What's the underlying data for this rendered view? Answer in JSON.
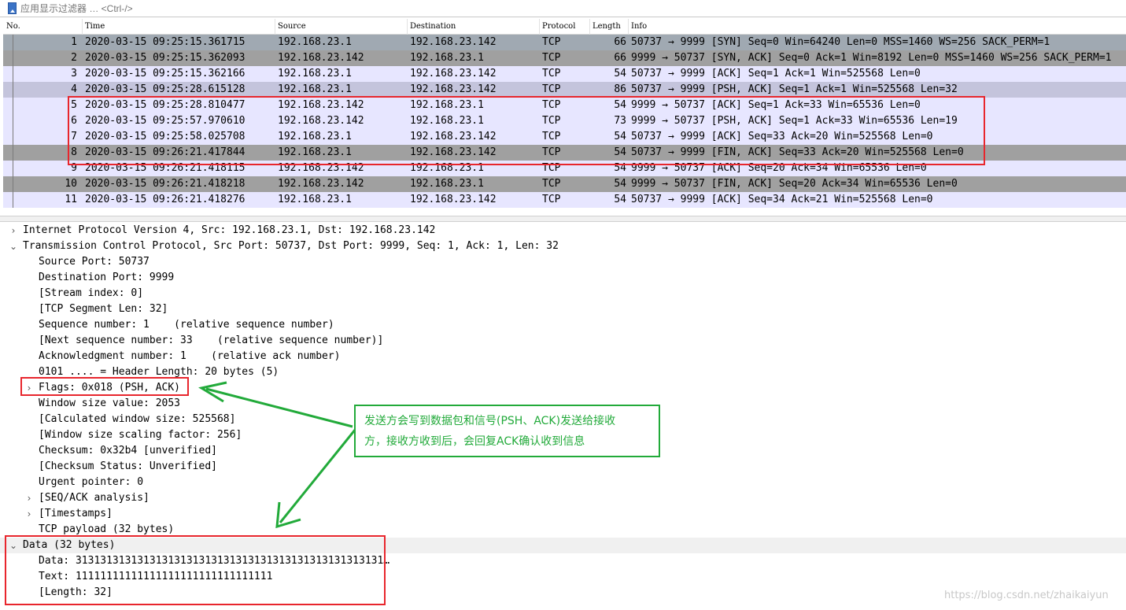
{
  "filter": {
    "placeholder": "应用显示过滤器 … <Ctrl-/>"
  },
  "packet_list": {
    "columns": {
      "no": "No.",
      "time": "Time",
      "source": "Source",
      "destination": "Destination",
      "protocol": "Protocol",
      "length": "Length",
      "info": "Info"
    },
    "rows": [
      {
        "no": "1",
        "time": "2020-03-15 09:25:15.361715",
        "source": "192.168.23.1",
        "destination": "192.168.23.142",
        "protocol": "TCP",
        "length": "66",
        "info": "50737 → 9999 [SYN] Seq=0 Win=64240 Len=0 MSS=1460 WS=256 SACK_PERM=1",
        "bg": "#a0a9b2"
      },
      {
        "no": "2",
        "time": "2020-03-15 09:25:15.362093",
        "source": "192.168.23.142",
        "destination": "192.168.23.1",
        "protocol": "TCP",
        "length": "66",
        "info": "9999 → 50737 [SYN, ACK] Seq=0 Ack=1 Win=8192 Len=0 MSS=1460 WS=256 SACK_PERM=1",
        "bg": "#a0a0a0"
      },
      {
        "no": "3",
        "time": "2020-03-15 09:25:15.362166",
        "source": "192.168.23.1",
        "destination": "192.168.23.142",
        "protocol": "TCP",
        "length": "54",
        "info": "50737 → 9999 [ACK] Seq=1 Ack=1 Win=525568 Len=0",
        "bg": "#e7e6ff"
      },
      {
        "no": "4",
        "time": "2020-03-15 09:25:28.615128",
        "source": "192.168.23.1",
        "destination": "192.168.23.142",
        "protocol": "TCP",
        "length": "86",
        "info": "50737 → 9999 [PSH, ACK] Seq=1 Ack=1 Win=525568 Len=32",
        "bg": "#c4c4dc"
      },
      {
        "no": "5",
        "time": "2020-03-15 09:25:28.810477",
        "source": "192.168.23.142",
        "destination": "192.168.23.1",
        "protocol": "TCP",
        "length": "54",
        "info": "9999 → 50737 [ACK] Seq=1 Ack=33 Win=65536 Len=0",
        "bg": "#e7e6ff"
      },
      {
        "no": "6",
        "time": "2020-03-15 09:25:57.970610",
        "source": "192.168.23.142",
        "destination": "192.168.23.1",
        "protocol": "TCP",
        "length": "73",
        "info": "9999 → 50737 [PSH, ACK] Seq=1 Ack=33 Win=65536 Len=19",
        "bg": "#e7e6ff"
      },
      {
        "no": "7",
        "time": "2020-03-15 09:25:58.025708",
        "source": "192.168.23.1",
        "destination": "192.168.23.142",
        "protocol": "TCP",
        "length": "54",
        "info": "50737 → 9999 [ACK] Seq=33 Ack=20 Win=525568 Len=0",
        "bg": "#e7e6ff"
      },
      {
        "no": "8",
        "time": "2020-03-15 09:26:21.417844",
        "source": "192.168.23.1",
        "destination": "192.168.23.142",
        "protocol": "TCP",
        "length": "54",
        "info": "50737 → 9999 [FIN, ACK] Seq=33 Ack=20 Win=525568 Len=0",
        "bg": "#a0a0a0"
      },
      {
        "no": "9",
        "time": "2020-03-15 09:26:21.418115",
        "source": "192.168.23.142",
        "destination": "192.168.23.1",
        "protocol": "TCP",
        "length": "54",
        "info": "9999 → 50737 [ACK] Seq=20 Ack=34 Win=65536 Len=0",
        "bg": "#e7e6ff"
      },
      {
        "no": "10",
        "time": "2020-03-15 09:26:21.418218",
        "source": "192.168.23.142",
        "destination": "192.168.23.1",
        "protocol": "TCP",
        "length": "54",
        "info": "9999 → 50737 [FIN, ACK] Seq=20 Ack=34 Win=65536 Len=0",
        "bg": "#a0a0a0"
      },
      {
        "no": "11",
        "time": "2020-03-15 09:26:21.418276",
        "source": "192.168.23.1",
        "destination": "192.168.23.142",
        "protocol": "TCP",
        "length": "54",
        "info": "50737 → 9999 [ACK] Seq=34 Ack=21 Win=525568 Len=0",
        "bg": "#e7e6ff"
      }
    ]
  },
  "details": [
    {
      "text": "Internet Protocol Version 4, Src: 192.168.23.1, Dst: 192.168.23.142",
      "level": 0,
      "arrow": "›"
    },
    {
      "text": "Transmission Control Protocol, Src Port: 50737, Dst Port: 9999, Seq: 1, Ack: 1, Len: 32",
      "level": 0,
      "arrow": "⌄"
    },
    {
      "text": "Source Port: 50737",
      "level": 1,
      "arrow": ""
    },
    {
      "text": "Destination Port: 9999",
      "level": 1,
      "arrow": ""
    },
    {
      "text": "[Stream index: 0]",
      "level": 1,
      "arrow": ""
    },
    {
      "text": "[TCP Segment Len: 32]",
      "level": 1,
      "arrow": ""
    },
    {
      "text": "Sequence number: 1    (relative sequence number)",
      "level": 1,
      "arrow": ""
    },
    {
      "text": "[Next sequence number: 33    (relative sequence number)]",
      "level": 1,
      "arrow": ""
    },
    {
      "text": "Acknowledgment number: 1    (relative ack number)",
      "level": 1,
      "arrow": ""
    },
    {
      "text": "0101 .... = Header Length: 20 bytes (5)",
      "level": 1,
      "arrow": ""
    },
    {
      "text": "Flags: 0x018 (PSH, ACK)",
      "level": 1,
      "arrow": "›"
    },
    {
      "text": "Window size value: 2053",
      "level": 1,
      "arrow": ""
    },
    {
      "text": "[Calculated window size: 525568]",
      "level": 1,
      "arrow": ""
    },
    {
      "text": "[Window size scaling factor: 256]",
      "level": 1,
      "arrow": ""
    },
    {
      "text": "Checksum: 0x32b4 [unverified]",
      "level": 1,
      "arrow": ""
    },
    {
      "text": "[Checksum Status: Unverified]",
      "level": 1,
      "arrow": ""
    },
    {
      "text": "Urgent pointer: 0",
      "level": 1,
      "arrow": ""
    },
    {
      "text": "[SEQ/ACK analysis]",
      "level": 1,
      "arrow": "›"
    },
    {
      "text": "[Timestamps]",
      "level": 1,
      "arrow": "›"
    },
    {
      "text": "TCP payload (32 bytes)",
      "level": 1,
      "arrow": ""
    },
    {
      "text": "Data (32 bytes)",
      "level": 0,
      "arrow": "⌄",
      "selected": true
    },
    {
      "text": "Data: 31313131313131313131313131313131313131313131313131…",
      "level": 1,
      "arrow": ""
    },
    {
      "text": "Text: 11111111111111111111111111111111",
      "level": 1,
      "arrow": ""
    },
    {
      "text": "[Length: 32]",
      "level": 1,
      "arrow": ""
    }
  ],
  "annotation": {
    "callout_line1": "发送方会写到数据包和信号(PSH、ACK)发送给接收",
    "callout_line2": "方，接收方收到后，会回复ACK确认收到信息"
  },
  "watermark": "https://blog.csdn.net/zhaikaiyun",
  "colors": {
    "red_box": "#e8262d",
    "green_annotation": "#22aa3a"
  }
}
